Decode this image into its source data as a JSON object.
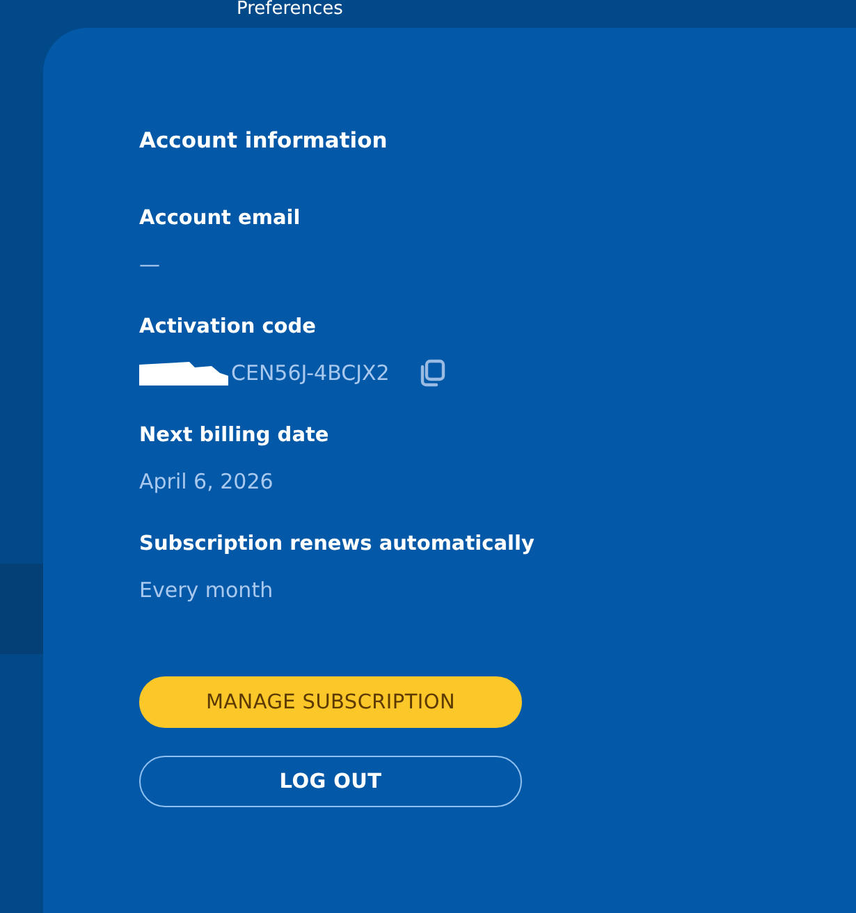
{
  "top_nav": {
    "tab_label": "Preferences"
  },
  "account": {
    "title": "Account information",
    "fields": [
      {
        "kind": "text",
        "label": "Account email",
        "value": "—"
      },
      {
        "kind": "code",
        "label": "Activation code",
        "value": "CEN56J-4BCJX2",
        "redacted": true
      },
      {
        "kind": "text",
        "label": "Next billing date",
        "value": "April 6, 2026"
      },
      {
        "kind": "text",
        "label": "Subscription renews automatically",
        "value": "Every month"
      }
    ],
    "buttons": [
      {
        "kind": "primary",
        "label": "MANAGE SUBSCRIPTION"
      },
      {
        "kind": "outline",
        "label": "LOG OUT"
      }
    ]
  }
}
